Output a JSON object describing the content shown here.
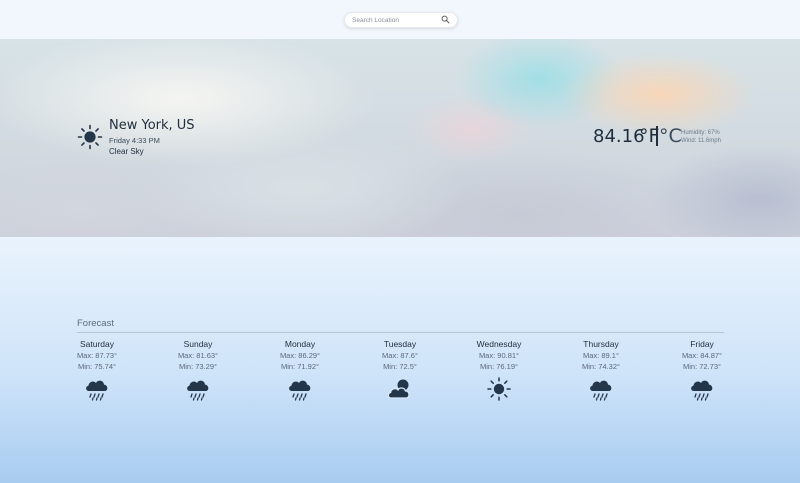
{
  "search": {
    "placeholder": "Search Location",
    "value": "",
    "icon": "search-icon"
  },
  "current": {
    "city": "New York, US",
    "datetime": "Friday 4:33 PM",
    "condition": "Clear Sky",
    "icon": "sun-icon",
    "temperature": "84.16",
    "unit_f": "°F",
    "unit_c": "°C",
    "humidity": "Humidity: 67%",
    "wind": "Wind: 11.6mph"
  },
  "forecast": {
    "title": "Forecast",
    "days": [
      {
        "name": "Saturday",
        "max": "Max: 87.73°",
        "min": "Min: 75.74°",
        "icon": "rain-cloud-icon"
      },
      {
        "name": "Sunday",
        "max": "Max: 81.63°",
        "min": "Min: 73.29°",
        "icon": "rain-cloud-icon"
      },
      {
        "name": "Monday",
        "max": "Max: 86.29°",
        "min": "Min: 71.92°",
        "icon": "rain-cloud-icon"
      },
      {
        "name": "Tuesday",
        "max": "Max: 87.6°",
        "min": "Min: 72.5°",
        "icon": "partly-cloudy-icon"
      },
      {
        "name": "Wednesday",
        "max": "Max: 90.81°",
        "min": "Min: 76.19°",
        "icon": "sun-icon"
      },
      {
        "name": "Thursday",
        "max": "Max: 89.1°",
        "min": "Min: 74.32°",
        "icon": "rain-cloud-icon"
      },
      {
        "name": "Friday",
        "max": "Max: 84.87°",
        "min": "Min: 72.73°",
        "icon": "rain-cloud-icon"
      }
    ]
  },
  "colors": {
    "text_dark": "#1f2d3d",
    "icon": "#24364a",
    "gradient_bottom": "#a8ccf0"
  }
}
